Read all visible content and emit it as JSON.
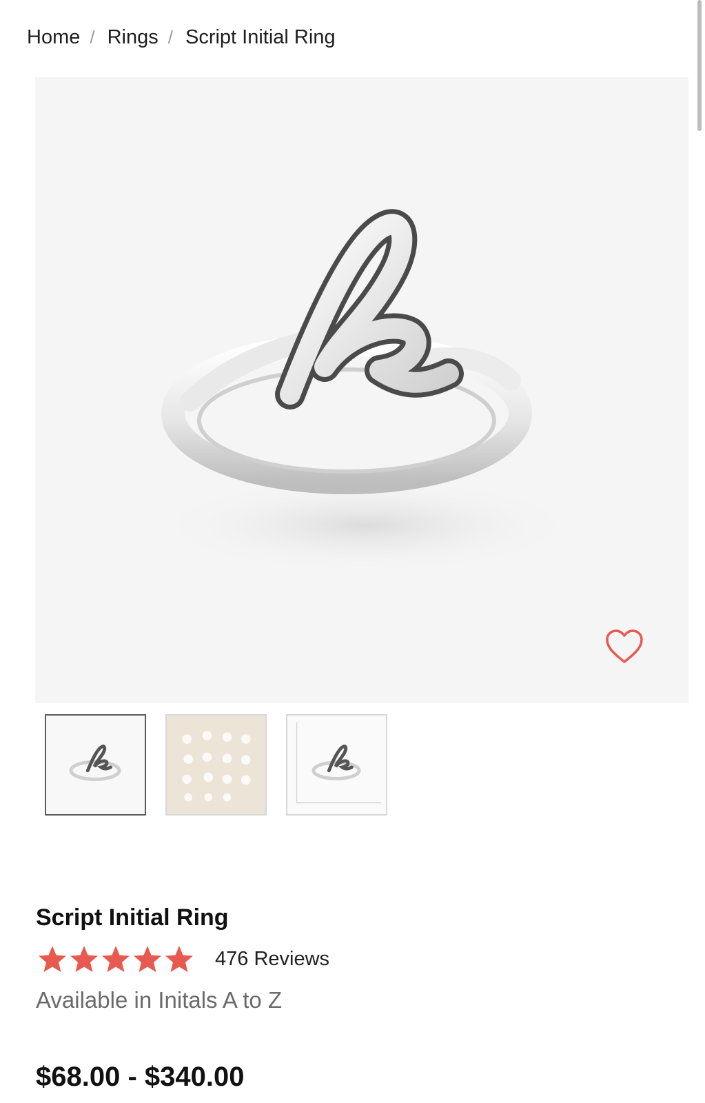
{
  "breadcrumb": {
    "items": [
      "Home",
      "Rings",
      "Script Initial Ring"
    ],
    "separator": "/"
  },
  "product": {
    "title": "Script Initial Ring",
    "rating_stars": 5,
    "reviews_label": "476 Reviews",
    "availability": "Available in Initals A to Z",
    "price_range": "$68.00 - $340.00"
  },
  "gallery": {
    "main_image": "script-k-ring-image",
    "thumbnails": [
      "ring-front-thumbnail",
      "initials-chart-thumbnail",
      "ring-scale-thumbnail"
    ],
    "active_thumbnail": 0
  },
  "icons": {
    "wishlist": "heart-icon",
    "rating": "star-icon"
  },
  "colors": {
    "accent": "#e85a4f",
    "image_background": "#f5f5f5",
    "muted_text": "#6b6b6b"
  }
}
